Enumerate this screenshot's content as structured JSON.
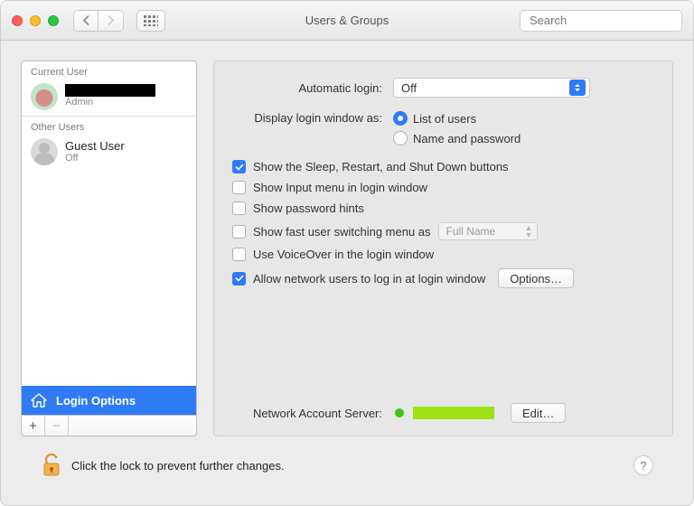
{
  "window": {
    "title": "Users & Groups",
    "search_placeholder": "Search"
  },
  "sidebar": {
    "current_user_label": "Current User",
    "other_users_label": "Other Users",
    "current_user": {
      "name": "████████",
      "role": "Admin"
    },
    "other_users": [
      {
        "name": "Guest User",
        "status": "Off"
      }
    ],
    "login_options_label": "Login Options",
    "add_label": "+",
    "remove_label": "−"
  },
  "content": {
    "auto_login_label": "Automatic login:",
    "auto_login_value": "Off",
    "display_label": "Display login window as:",
    "radio_list": "List of users",
    "radio_namepw": "Name and password",
    "checks": {
      "sleep": "Show the Sleep, Restart, and Shut Down buttons",
      "input_menu": "Show Input menu in login window",
      "pw_hints": "Show password hints",
      "fast_switch": "Show fast user switching menu as",
      "fast_switch_value": "Full Name",
      "voiceover": "Use VoiceOver in the login window",
      "network_users": "Allow network users to log in at login window"
    },
    "options_btn": "Options…",
    "nas_label": "Network Account Server:",
    "edit_btn": "Edit…"
  },
  "footer": {
    "lock_text": "Click the lock to prevent further changes.",
    "help": "?"
  }
}
